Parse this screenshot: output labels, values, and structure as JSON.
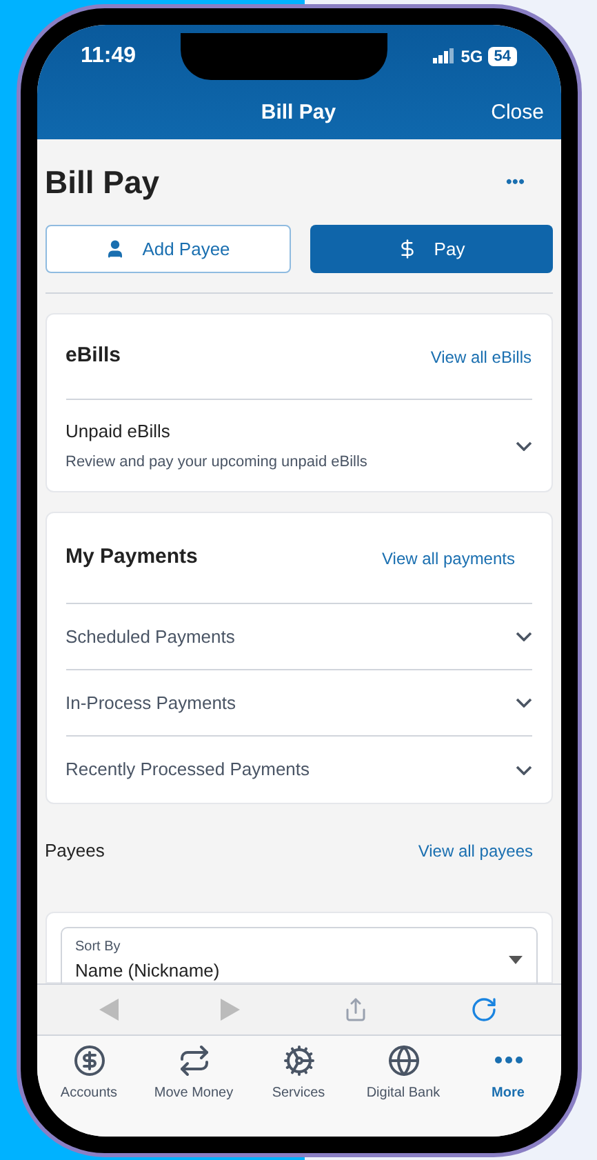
{
  "status_bar": {
    "time": "11:49",
    "network": "5G",
    "battery": "54"
  },
  "nav_bar": {
    "title": "Bill Pay",
    "close": "Close"
  },
  "page": {
    "title": "Bill Pay",
    "more": "•••"
  },
  "actions": [
    {
      "label": "Add Payee",
      "kind": "outline"
    },
    {
      "label": "Pay",
      "kind": "filled"
    }
  ],
  "ebills": {
    "title": "eBills",
    "link": "View all eBills",
    "rows": [
      {
        "title": "Unpaid eBills",
        "subtitle": "Review and pay your upcoming unpaid eBills",
        "expanded": false
      }
    ]
  },
  "my_payments": {
    "title": "My Payments",
    "link": "View all payments",
    "rows": [
      {
        "title": "Scheduled Payments",
        "expanded": false
      },
      {
        "title": "In-Process Payments",
        "expanded": false
      },
      {
        "title": "Recently Processed Payments",
        "expanded": false
      }
    ]
  },
  "payees": {
    "title": "Payees",
    "link": "View all payees",
    "sort_field": {
      "label": "Sort By",
      "value": "Name (Nickname)"
    }
  },
  "browser_toolbar": {
    "back_disabled": true,
    "forward_disabled": true
  },
  "tab_bar": [
    {
      "label": "Accounts",
      "selected": false
    },
    {
      "label": "Move Money",
      "selected": false
    },
    {
      "label": "Services",
      "selected": false
    },
    {
      "label": "Digital Bank",
      "selected": false
    },
    {
      "label": "More",
      "selected": true
    }
  ]
}
